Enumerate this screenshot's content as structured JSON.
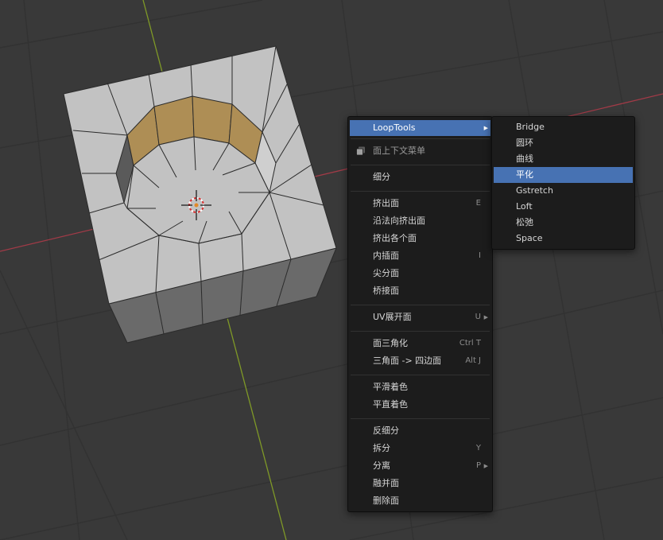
{
  "viewport": {
    "background": "#393939",
    "grid_color": "#323232",
    "x_axis_color": "#a13a47",
    "y_axis_color": "#7f9927",
    "mesh_face_color": "#bfbfbf",
    "selected_face_color": "#ae8e55",
    "edge_color": "#2b2b2b",
    "cursor_icon": "3d-cursor-icon"
  },
  "context_menu": {
    "items": [
      {
        "label": "LoopTools",
        "shortcut": "",
        "submenu": true,
        "highlighted": true
      },
      {
        "label": "面上下文菜单",
        "header": true,
        "icon": "face-menu-icon"
      },
      {
        "label": "细分",
        "shortcut": ""
      },
      {
        "label": "挤出面",
        "shortcut": "E"
      },
      {
        "label": "沿法向挤出面",
        "shortcut": ""
      },
      {
        "label": "挤出各个面",
        "shortcut": ""
      },
      {
        "label": "内插面",
        "shortcut": "I"
      },
      {
        "label": "尖分面",
        "shortcut": ""
      },
      {
        "label": "桥接面",
        "shortcut": ""
      },
      {
        "label": "UV展开面",
        "shortcut": "U",
        "submenu": true
      },
      {
        "label": "面三角化",
        "shortcut": "Ctrl T"
      },
      {
        "label": "三角面 -> 四边面",
        "shortcut": "Alt J"
      },
      {
        "label": "平滑着色",
        "shortcut": ""
      },
      {
        "label": "平直着色",
        "shortcut": ""
      },
      {
        "label": "反细分",
        "shortcut": ""
      },
      {
        "label": "拆分",
        "shortcut": "Y"
      },
      {
        "label": "分离",
        "shortcut": "P",
        "submenu": true
      },
      {
        "label": "融并面",
        "shortcut": ""
      },
      {
        "label": "删除面",
        "shortcut": ""
      }
    ]
  },
  "looptools_menu": {
    "items": [
      {
        "label": "Bridge"
      },
      {
        "label": "圆环"
      },
      {
        "label": "曲线"
      },
      {
        "label": "平化",
        "highlighted": true
      },
      {
        "label": "Gstretch"
      },
      {
        "label": "Loft"
      },
      {
        "label": "松弛"
      },
      {
        "label": "Space"
      }
    ]
  }
}
